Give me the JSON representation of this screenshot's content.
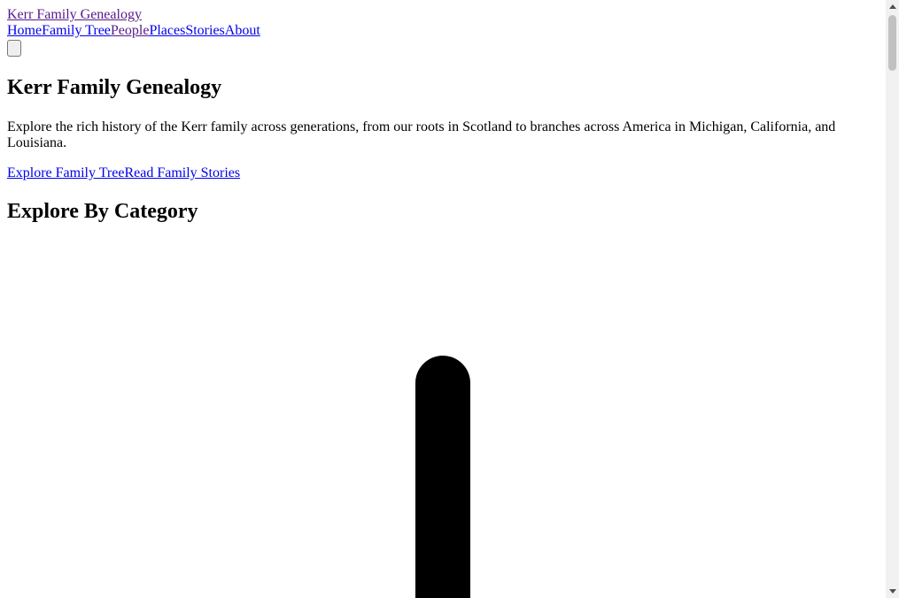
{
  "header": {
    "logo_text": "Kerr Family Genealogy",
    "nav": [
      {
        "label": "Home"
      },
      {
        "label": "Family Tree"
      },
      {
        "label": "People"
      },
      {
        "label": "Places"
      },
      {
        "label": "Stories"
      },
      {
        "label": "About"
      }
    ]
  },
  "hero": {
    "title": "Kerr Family Genealogy",
    "description": "Explore the rich history of the Kerr family across generations, from our roots in Scotland to branches across America in Michigan, California, and Louisiana.",
    "primary_cta": "Explore Family Tree",
    "secondary_cta": "Read Family Stories"
  },
  "categories": {
    "heading": "Explore By Category"
  },
  "colors": {
    "link": "#0000ee",
    "visited_link": "#551a8b",
    "text": "#000000",
    "background": "#ffffff"
  }
}
